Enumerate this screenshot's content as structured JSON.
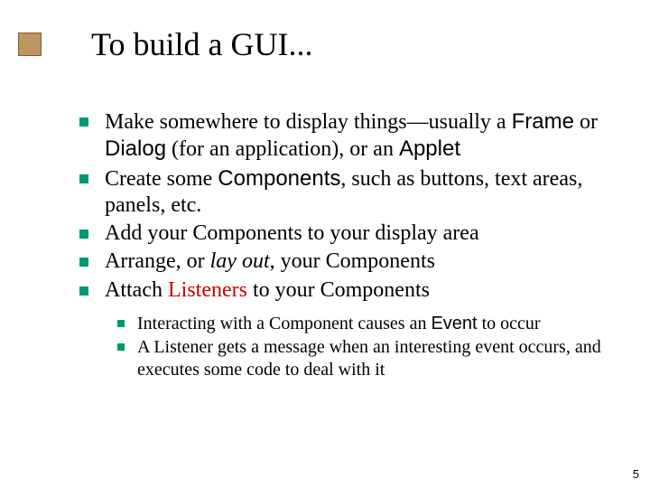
{
  "title": "To build a GUI...",
  "bullets": [
    {
      "segments": [
        {
          "text": "Make somewhere to display things—usually a "
        },
        {
          "text": "Frame",
          "cls": "code-like"
        },
        {
          "text": " or "
        },
        {
          "text": "Dialog",
          "cls": "code-like"
        },
        {
          "text": " (for an application), or an "
        },
        {
          "text": "Applet",
          "cls": "code-like"
        }
      ]
    },
    {
      "segments": [
        {
          "text": "Create some "
        },
        {
          "text": "Components",
          "cls": "code-like"
        },
        {
          "text": ", such as buttons, text areas, panels, etc."
        }
      ]
    },
    {
      "segments": [
        {
          "text": "Add your Components to your display area"
        }
      ]
    },
    {
      "segments": [
        {
          "text": "Arrange, or "
        },
        {
          "text": "lay out",
          "cls": "italic"
        },
        {
          "text": ", your Components"
        }
      ]
    },
    {
      "segments": [
        {
          "text": "Attach "
        },
        {
          "text": "Listeners",
          "cls": "red"
        },
        {
          "text": " to your Components"
        }
      ]
    }
  ],
  "subbullets": [
    {
      "segments": [
        {
          "text": "Interacting with a Component causes an "
        },
        {
          "text": "Event",
          "cls": "code-like"
        },
        {
          "text": " to occur"
        }
      ]
    },
    {
      "segments": [
        {
          "text": "A Listener gets a message when an interesting event occurs, and executes some code to deal with it"
        }
      ]
    }
  ],
  "page_number": "5"
}
